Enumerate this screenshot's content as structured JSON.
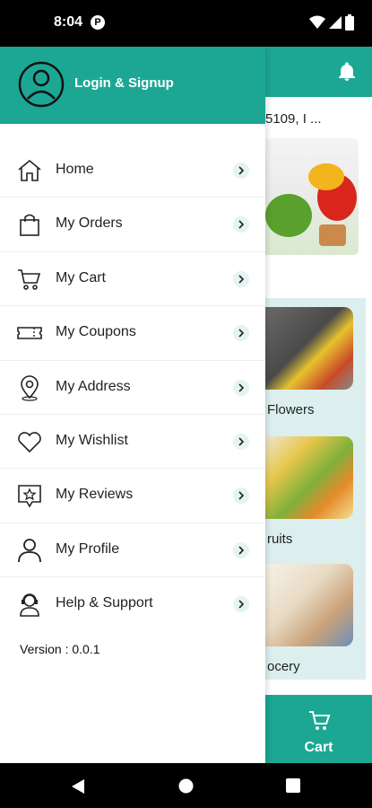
{
  "status_bar": {
    "time": "8:04",
    "notification_letter": "P"
  },
  "drawer": {
    "header_label": "Login & Signup",
    "menu": [
      {
        "label": "Home",
        "icon": "home-icon"
      },
      {
        "label": "My Orders",
        "icon": "shopping-bag-icon"
      },
      {
        "label": "My Cart",
        "icon": "cart-icon"
      },
      {
        "label": "My Coupons",
        "icon": "coupon-icon"
      },
      {
        "label": "My Address",
        "icon": "location-pin-icon"
      },
      {
        "label": "My Wishlist",
        "icon": "heart-icon"
      },
      {
        "label": "My Reviews",
        "icon": "review-star-icon"
      },
      {
        "label": "My Profile",
        "icon": "person-icon"
      },
      {
        "label": "Help & Support",
        "icon": "support-agent-icon"
      }
    ],
    "version": "Version : 0.0.1"
  },
  "background": {
    "address": "5109, I ...",
    "categories": [
      "Flowers",
      "ruits",
      "ocery"
    ],
    "cart_label": "Cart"
  },
  "colors": {
    "brand_teal": "#1ba794",
    "category_panel": "#dcefee"
  }
}
